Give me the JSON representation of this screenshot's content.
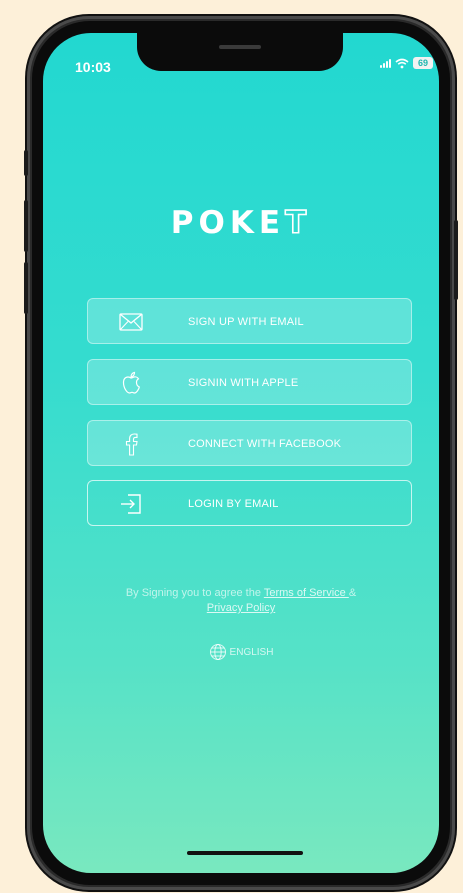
{
  "status_bar": {
    "time": "10:03",
    "battery": "69",
    "icons": [
      "signal-icon",
      "wifi-icon",
      "battery-icon"
    ]
  },
  "app": {
    "logo_main": "POKE",
    "logo_accent": "T"
  },
  "buttons": [
    {
      "label": "SIGN UP WITH EMAIL",
      "icon": "envelope-icon"
    },
    {
      "label": "SIGNIN WITH APPLE",
      "icon": "apple-icon"
    },
    {
      "label": "CONNECT WITH FACEBOOK",
      "icon": "facebook-icon"
    },
    {
      "label": "LOGIN BY EMAIL",
      "icon": "login-icon"
    }
  ],
  "legal": {
    "prefix": "By Signing you to agree the ",
    "terms_link": "Terms of Service ",
    "conjunction": "&",
    "privacy_link": "Privacy Policy"
  },
  "language": {
    "label": "ENGLISH",
    "icon": "globe-icon"
  },
  "colors": {
    "background": "#fdf0d9",
    "gradient_top": "#22d8d0",
    "gradient_bottom": "#79e8bf",
    "text": "#ffffff"
  }
}
